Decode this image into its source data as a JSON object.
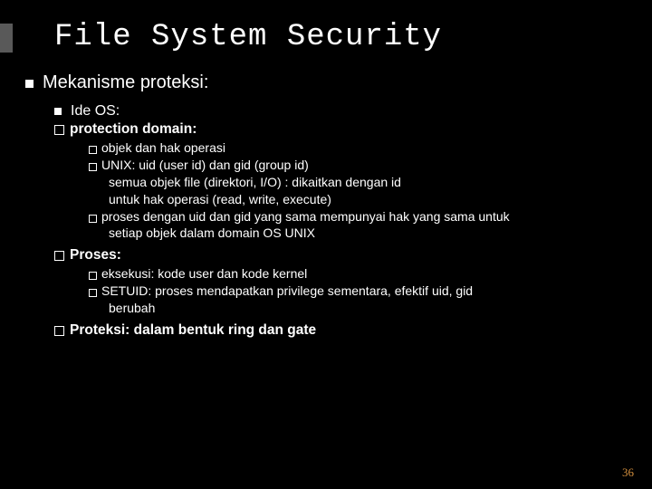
{
  "title": "File System Security",
  "lvl1": "Mekanisme proteksi:",
  "lvl2": "Ide OS:",
  "pd_label": "protection domain:",
  "pd_i1": "objek  dan  hak operasi",
  "pd_i2a": "UNIX:  uid  (user id)  dan gid (group id)",
  "pd_i2b": "semua objek file (direktori, I/O) : dikaitkan dengan id",
  "pd_i2c": "untuk hak operasi (read, write, execute)",
  "pd_i3a": "proses dengan uid dan gid yang sama mempunyai hak yang sama untuk",
  "pd_i3b": "setiap objek dalam domain OS UNIX",
  "proses_label": "Proses:",
  "pr_i1": "eksekusi: kode user  dan kode kernel",
  "pr_i2a": "SETUID: proses mendapatkan privilege sementara, efektif uid, gid",
  "pr_i2b": "berubah",
  "proteksi": "Proteksi: dalam bentuk ring dan gate",
  "page": "36"
}
